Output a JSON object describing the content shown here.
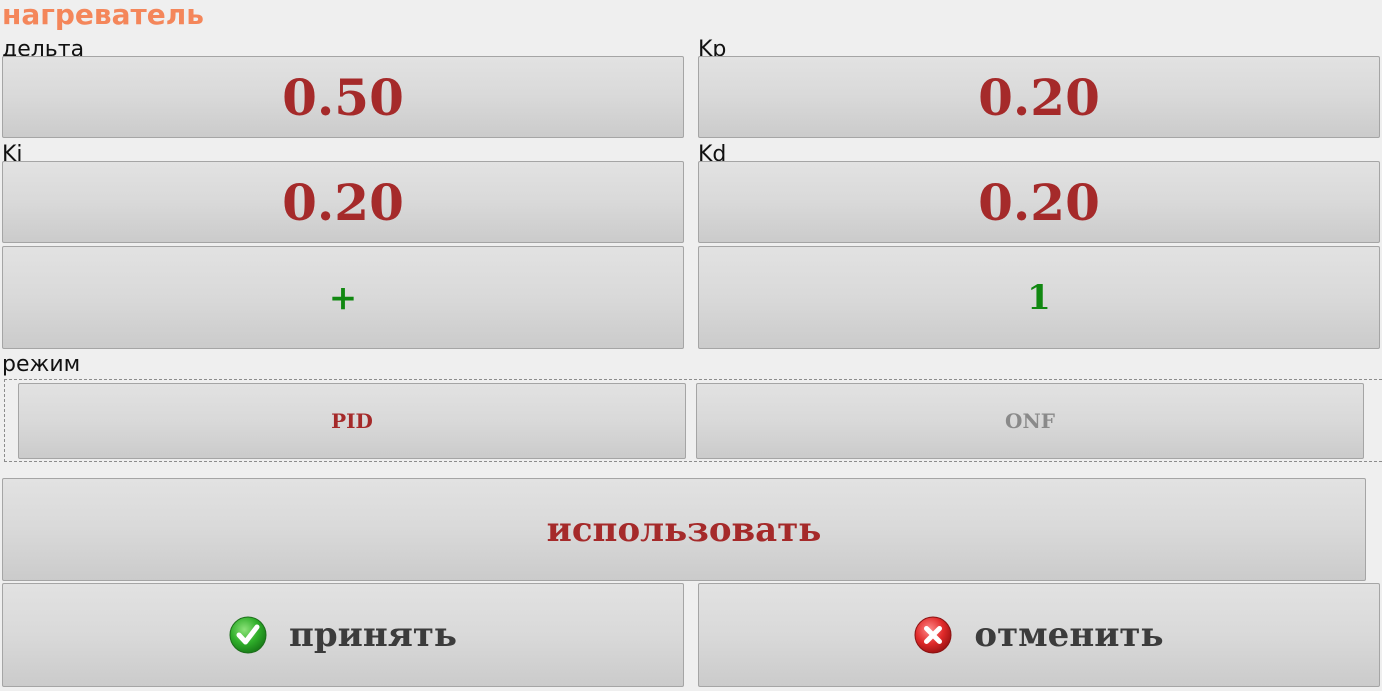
{
  "title": "нагреватель",
  "fields": {
    "delta": {
      "label": "дельта",
      "value": "0.50"
    },
    "kp": {
      "label": "Kp",
      "value": "0.20"
    },
    "ki": {
      "label": "Ki",
      "value": "0.20"
    },
    "kd": {
      "label": "Kd",
      "value": "0.20"
    }
  },
  "sign_button": "+",
  "count_button": "1",
  "mode": {
    "label": "режим",
    "options": [
      "PID",
      "ONF"
    ],
    "selected": "PID"
  },
  "use_button": "использовать",
  "accept_button": {
    "label": "принять",
    "icon": "check-circle-icon"
  },
  "cancel_button": {
    "label": "отменить",
    "icon": "x-circle-icon"
  },
  "colors": {
    "title": "#f4865a",
    "value": "#a52a2a",
    "green": "#118811",
    "inactive": "#8a8a8a",
    "background": "#efefef"
  }
}
